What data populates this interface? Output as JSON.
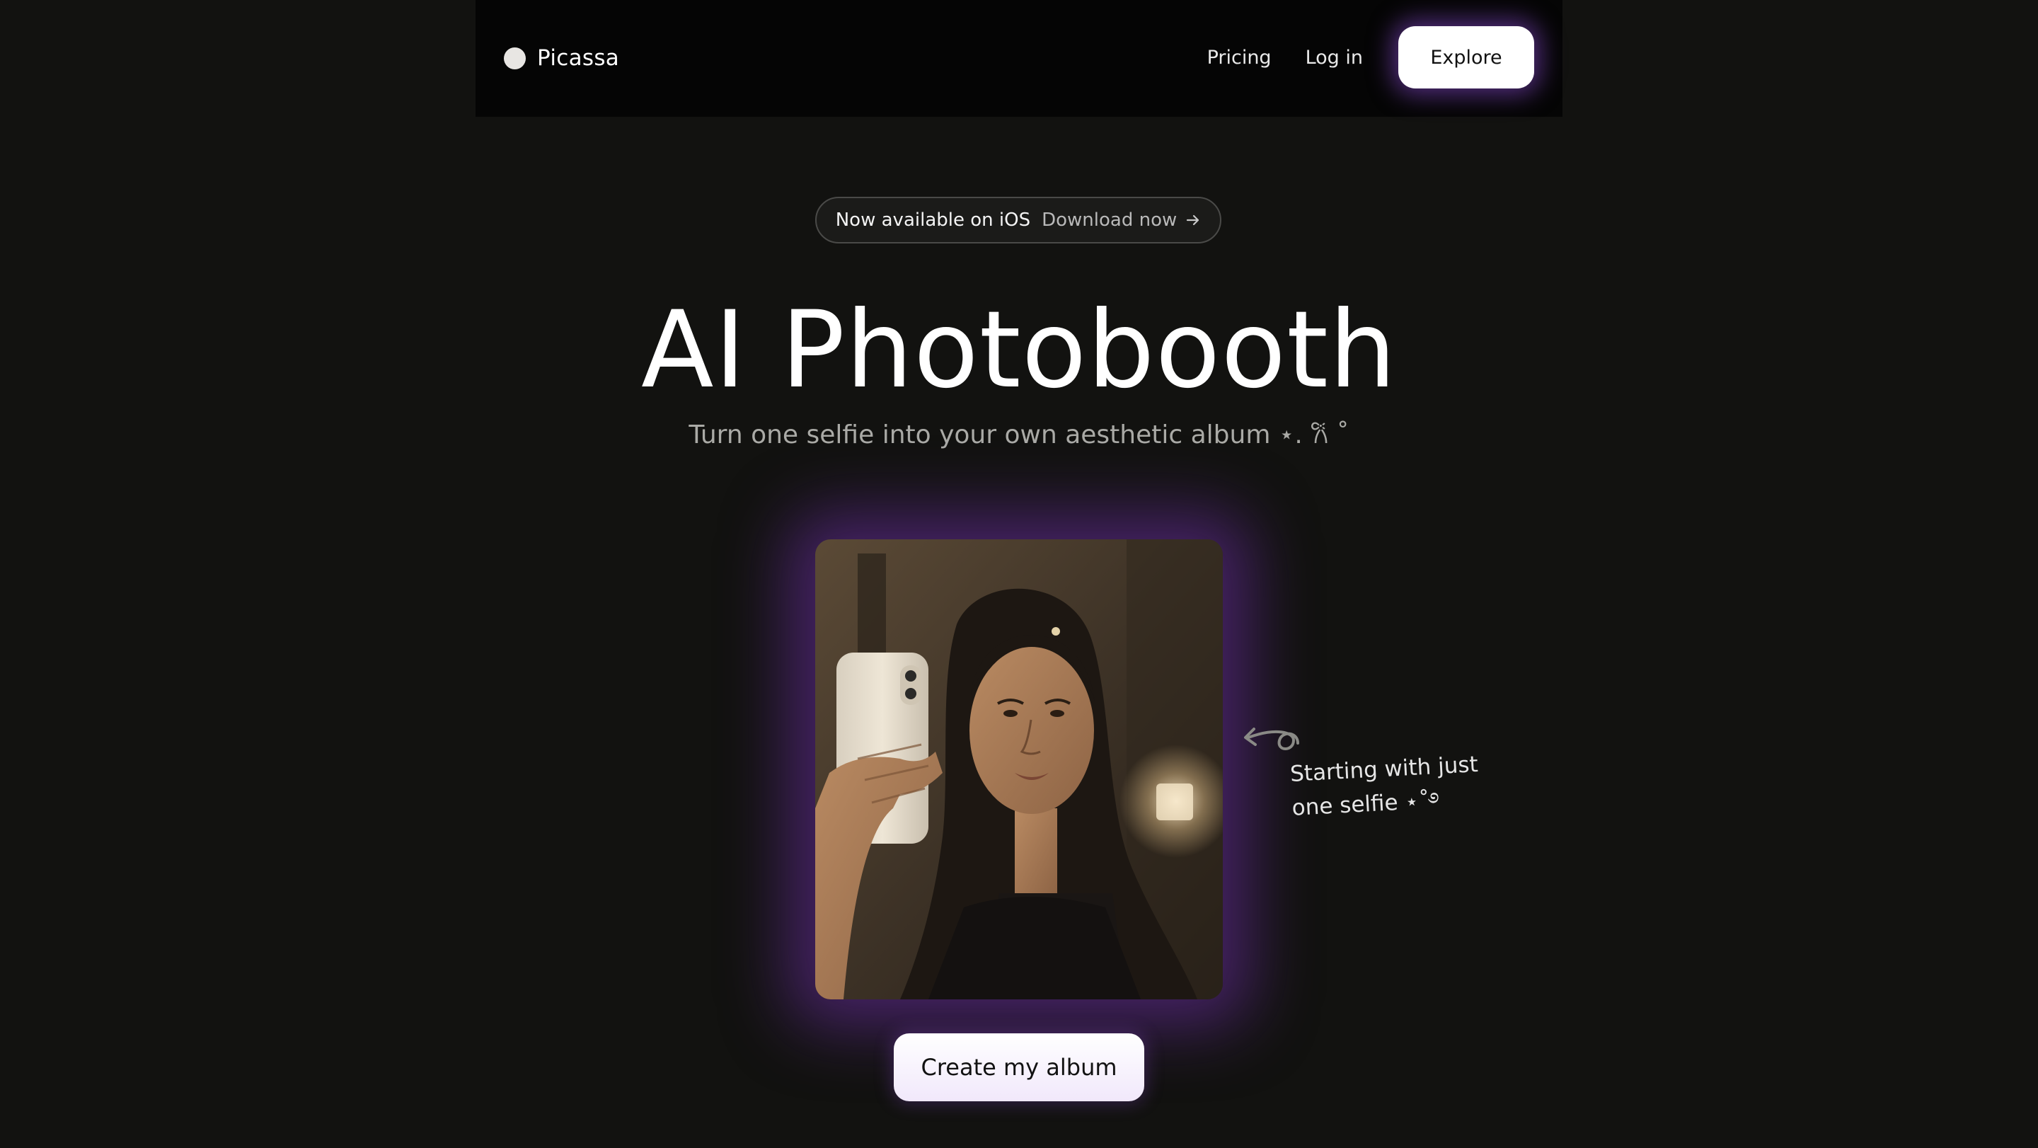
{
  "nav": {
    "brand_name": "Picassa",
    "links": {
      "pricing": "Pricing",
      "login": "Log in"
    },
    "cta_label": "Explore"
  },
  "badge": {
    "text": "Now available on iOS",
    "link_text": "Download now",
    "icon": "arrow-right-icon"
  },
  "hero": {
    "title": "AI Photobooth",
    "subtitle": "Turn one selfie into your own aesthetic album ⋆. 𐙚 ˚"
  },
  "photo": {
    "icon": "selfie-photo"
  },
  "annotation": {
    "line1": "Starting with just",
    "line2": "one selfie ⋆˚࿔",
    "icon": "curly-arrow-icon"
  },
  "cta": {
    "label": "Create my album"
  },
  "colors": {
    "background": "#121210",
    "nav_background": "#050505",
    "glow": "#7030aa",
    "button_bg": "#ffffff",
    "subtitle": "#aaaaa6"
  }
}
